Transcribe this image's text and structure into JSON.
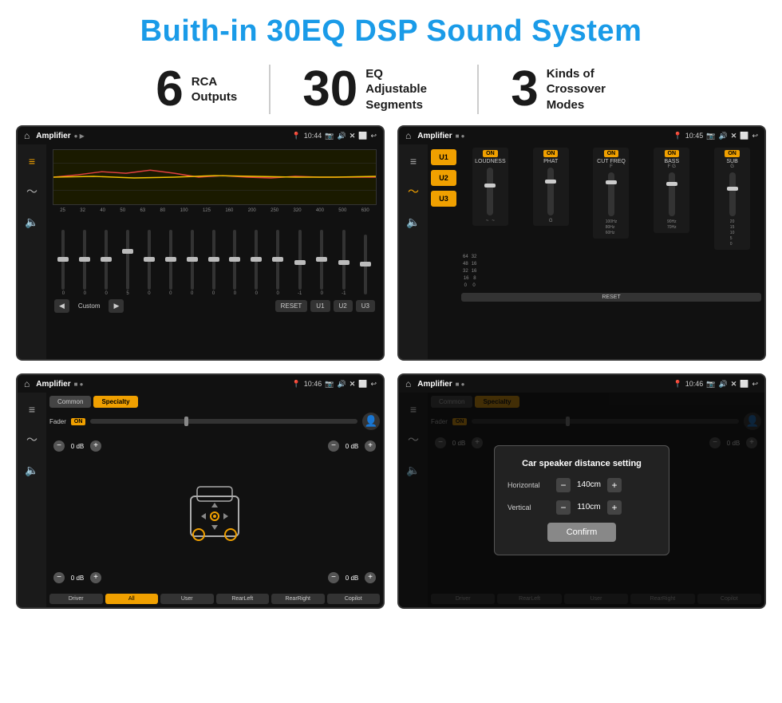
{
  "page": {
    "title": "Buith-in 30EQ DSP Sound System",
    "stats": [
      {
        "number": "6",
        "label": "RCA\nOutputs"
      },
      {
        "number": "30",
        "label": "EQ Adjustable\nSegments"
      },
      {
        "number": "3",
        "label": "Kinds of\nCrossover Modes"
      }
    ]
  },
  "screen1": {
    "title": "Amplifier",
    "time": "10:44",
    "eq_freqs": [
      "25",
      "32",
      "40",
      "50",
      "63",
      "80",
      "100",
      "125",
      "160",
      "200",
      "250",
      "320",
      "400",
      "500",
      "630"
    ],
    "eq_values": [
      "0",
      "0",
      "0",
      "5",
      "0",
      "0",
      "0",
      "0",
      "0",
      "0",
      "0",
      "-1",
      "0",
      "-1",
      ""
    ],
    "buttons": [
      "Custom",
      "RESET",
      "U1",
      "U2",
      "U3"
    ]
  },
  "screen2": {
    "title": "Amplifier",
    "time": "10:45",
    "u_buttons": [
      "U1",
      "U2",
      "U3"
    ],
    "controls": [
      "LOUDNESS",
      "PHAT",
      "CUT FREQ",
      "BASS",
      "SUB"
    ],
    "reset_label": "RESET"
  },
  "screen3": {
    "title": "Amplifier",
    "time": "10:46",
    "tabs": [
      "Common",
      "Specialty"
    ],
    "fader_label": "Fader",
    "fader_on": "ON",
    "db_values": [
      "0 dB",
      "0 dB",
      "0 dB",
      "0 dB"
    ],
    "buttons": [
      "Driver",
      "All",
      "User",
      "RearLeft",
      "RearRight",
      "Copilot"
    ]
  },
  "screen4": {
    "title": "Amplifier",
    "time": "10:46",
    "tabs": [
      "Common",
      "Specialty"
    ],
    "dialog": {
      "title": "Car speaker distance setting",
      "horizontal_label": "Horizontal",
      "horizontal_value": "140cm",
      "vertical_label": "Vertical",
      "vertical_value": "110cm",
      "confirm_label": "Confirm"
    },
    "db_values": [
      "0 dB",
      "0 dB"
    ],
    "buttons": [
      "Driver",
      "RearLeft",
      "User",
      "RearRight",
      "Copilot"
    ]
  }
}
